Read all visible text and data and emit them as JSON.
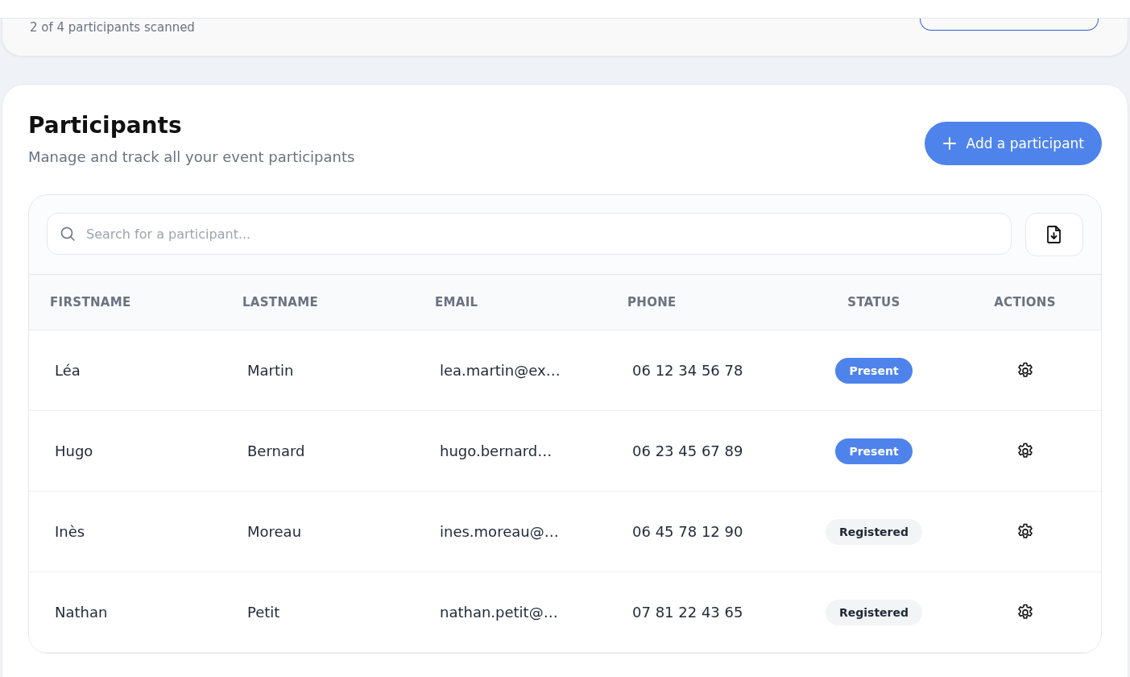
{
  "scan_summary": {
    "text": "2 of 4 participants scanned"
  },
  "participants": {
    "title": "Participants",
    "subtitle": "Manage and track all your event participants",
    "add_button": "Add a participant",
    "search": {
      "placeholder": "Search for a participant..."
    },
    "table": {
      "columns": [
        "FIRSTNAME",
        "LASTNAME",
        "EMAIL",
        "PHONE",
        "STATUS",
        "ACTIONS"
      ],
      "rows": [
        {
          "firstname": "Léa",
          "lastname": "Martin",
          "email": "lea.martin@ex…",
          "phone": "06 12 34 56 78",
          "status": {
            "label": "Present",
            "kind": "present"
          }
        },
        {
          "firstname": "Hugo",
          "lastname": "Bernard",
          "email": "hugo.bernard…",
          "phone": "06 23 45 67 89",
          "status": {
            "label": "Present",
            "kind": "present"
          }
        },
        {
          "firstname": "Inès",
          "lastname": "Moreau",
          "email": "ines.moreau@…",
          "phone": "06 45 78 12 90",
          "status": {
            "label": "Registered",
            "kind": "registered"
          }
        },
        {
          "firstname": "Nathan",
          "lastname": "Petit",
          "email": "nathan.petit@…",
          "phone": "07 81 22 43 65",
          "status": {
            "label": "Registered",
            "kind": "registered"
          }
        }
      ]
    }
  }
}
